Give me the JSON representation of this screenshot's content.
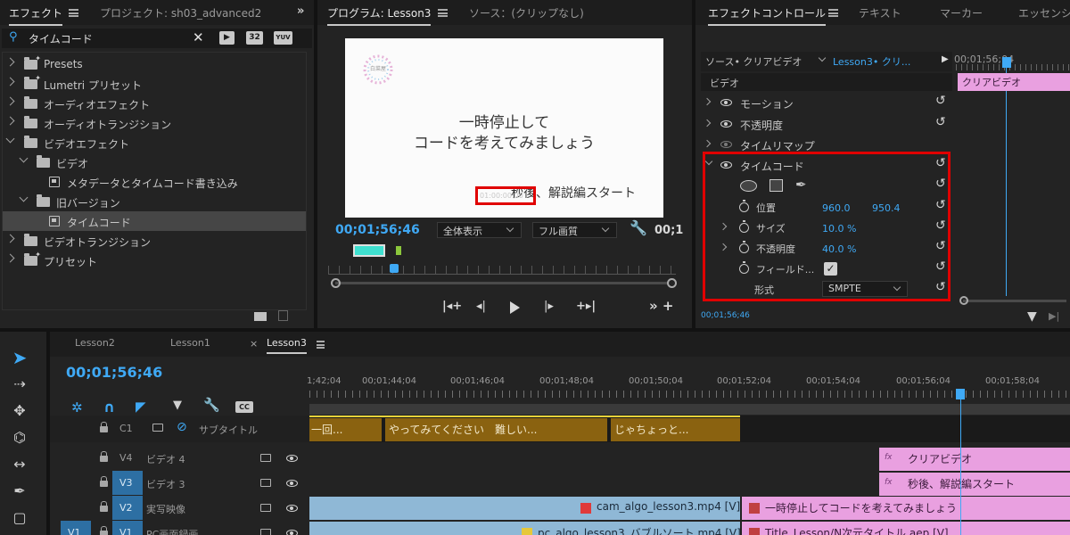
{
  "effects_panel": {
    "tab_effects": "エフェクト",
    "tab_project": "プロジェクト: sh03_advanced2",
    "search_value": "タイムコード",
    "badge_32": "32",
    "badge_yuv": "YUV",
    "tree": [
      {
        "label": "Presets"
      },
      {
        "label": "Lumetri プリセット"
      },
      {
        "label": "オーディオエフェクト"
      },
      {
        "label": "オーディオトランジション"
      },
      {
        "label": "ビデオエフェクト"
      },
      {
        "label": "ビデオ"
      },
      {
        "label": "メタデータとタイムコード書き込み"
      },
      {
        "label": "旧バージョン"
      },
      {
        "label": "タイムコード"
      },
      {
        "label": "ビデオトランジション"
      },
      {
        "label": "プリセット"
      }
    ]
  },
  "program_monitor": {
    "tab_program": "プログラム: Lesson3",
    "tab_source": "ソース：(クリップなし)",
    "logo_text": "白菜屋",
    "frame_text_line1": "一時停止して",
    "frame_text_line2": "コードを考えてみましょう",
    "frame_subtext": "秒後、解説編スタート",
    "timecode_overlay": "01:00:00:00",
    "current_time": "00;01;56;46",
    "zoom_select": "全体表示",
    "quality_select": "フル画質",
    "end_time_partial": "00;1"
  },
  "effect_controls": {
    "tab_effect_controls": "エフェクトコントロール",
    "tab_text": "テキスト",
    "tab_marker": "マーカー",
    "tab_essential": "エッセンシ",
    "source_label": "ソース• クリアビデオ",
    "sequence_label": "Lesson3• クリ...",
    "mini_time": "00;01;56;04",
    "clip_bar": "クリアビデオ",
    "video_header": "ビデオ",
    "motion": "モーション",
    "opacity": "不透明度",
    "time_remap": "タイムリマップ",
    "timecode_effect": "タイムコード",
    "position_label": "位置",
    "position_x": "960.0",
    "position_y": "950.4",
    "size_label": "サイズ",
    "size_value": "10.0 %",
    "opacity2_label": "不透明度",
    "opacity2_value": "40.0 %",
    "field_label": "フィールド...",
    "format_label": "形式",
    "format_value": "SMPTE",
    "footer_time": "00;01;56;46"
  },
  "timeline": {
    "tabs": [
      "Lesson2",
      "Lesson1",
      "Lesson3"
    ],
    "timecode": "00;01;56;46",
    "ruler": [
      "1;42;04",
      "00;01;44;04",
      "00;01;46;04",
      "00;01;48;04",
      "00;01;50;04",
      "00;01;52;04",
      "00;01;54;04",
      "00;01;56;04",
      "00;01;58;04"
    ],
    "cc_label": "CC",
    "tracks": [
      {
        "id": "C1",
        "name": "サブタイトル"
      },
      {
        "id": "V4",
        "name": "ビデオ 4"
      },
      {
        "id": "V3",
        "name": "ビデオ 3"
      },
      {
        "id": "V2",
        "name": "実写映像"
      },
      {
        "id": "V1",
        "src": "V1",
        "name": "PC画面録画"
      }
    ],
    "subtitles": [
      "一回...",
      "やってみてください　難しい...",
      "じゃちょっと..."
    ],
    "clip_v4": "クリアビデオ",
    "clip_v3": "秒後、解説編スタート",
    "clip_v2a": "cam_algo_lesson3.mp4 [V]",
    "clip_v2b": "一時停止してコードを考えてみましょう",
    "clip_v1a": "pc_algo_lesson3_バブルソート.mp4 [V]",
    "clip_v1b": "Title_Lesson/N次元タイトル.aep [V]"
  },
  "colors": {
    "accent_blue": "#3fa9f5",
    "highlight_red": "#e00000",
    "clip_pink": "#e9a0e0",
    "clip_blue": "#8fb8d6",
    "subtitle_gold": "#8a6210"
  }
}
